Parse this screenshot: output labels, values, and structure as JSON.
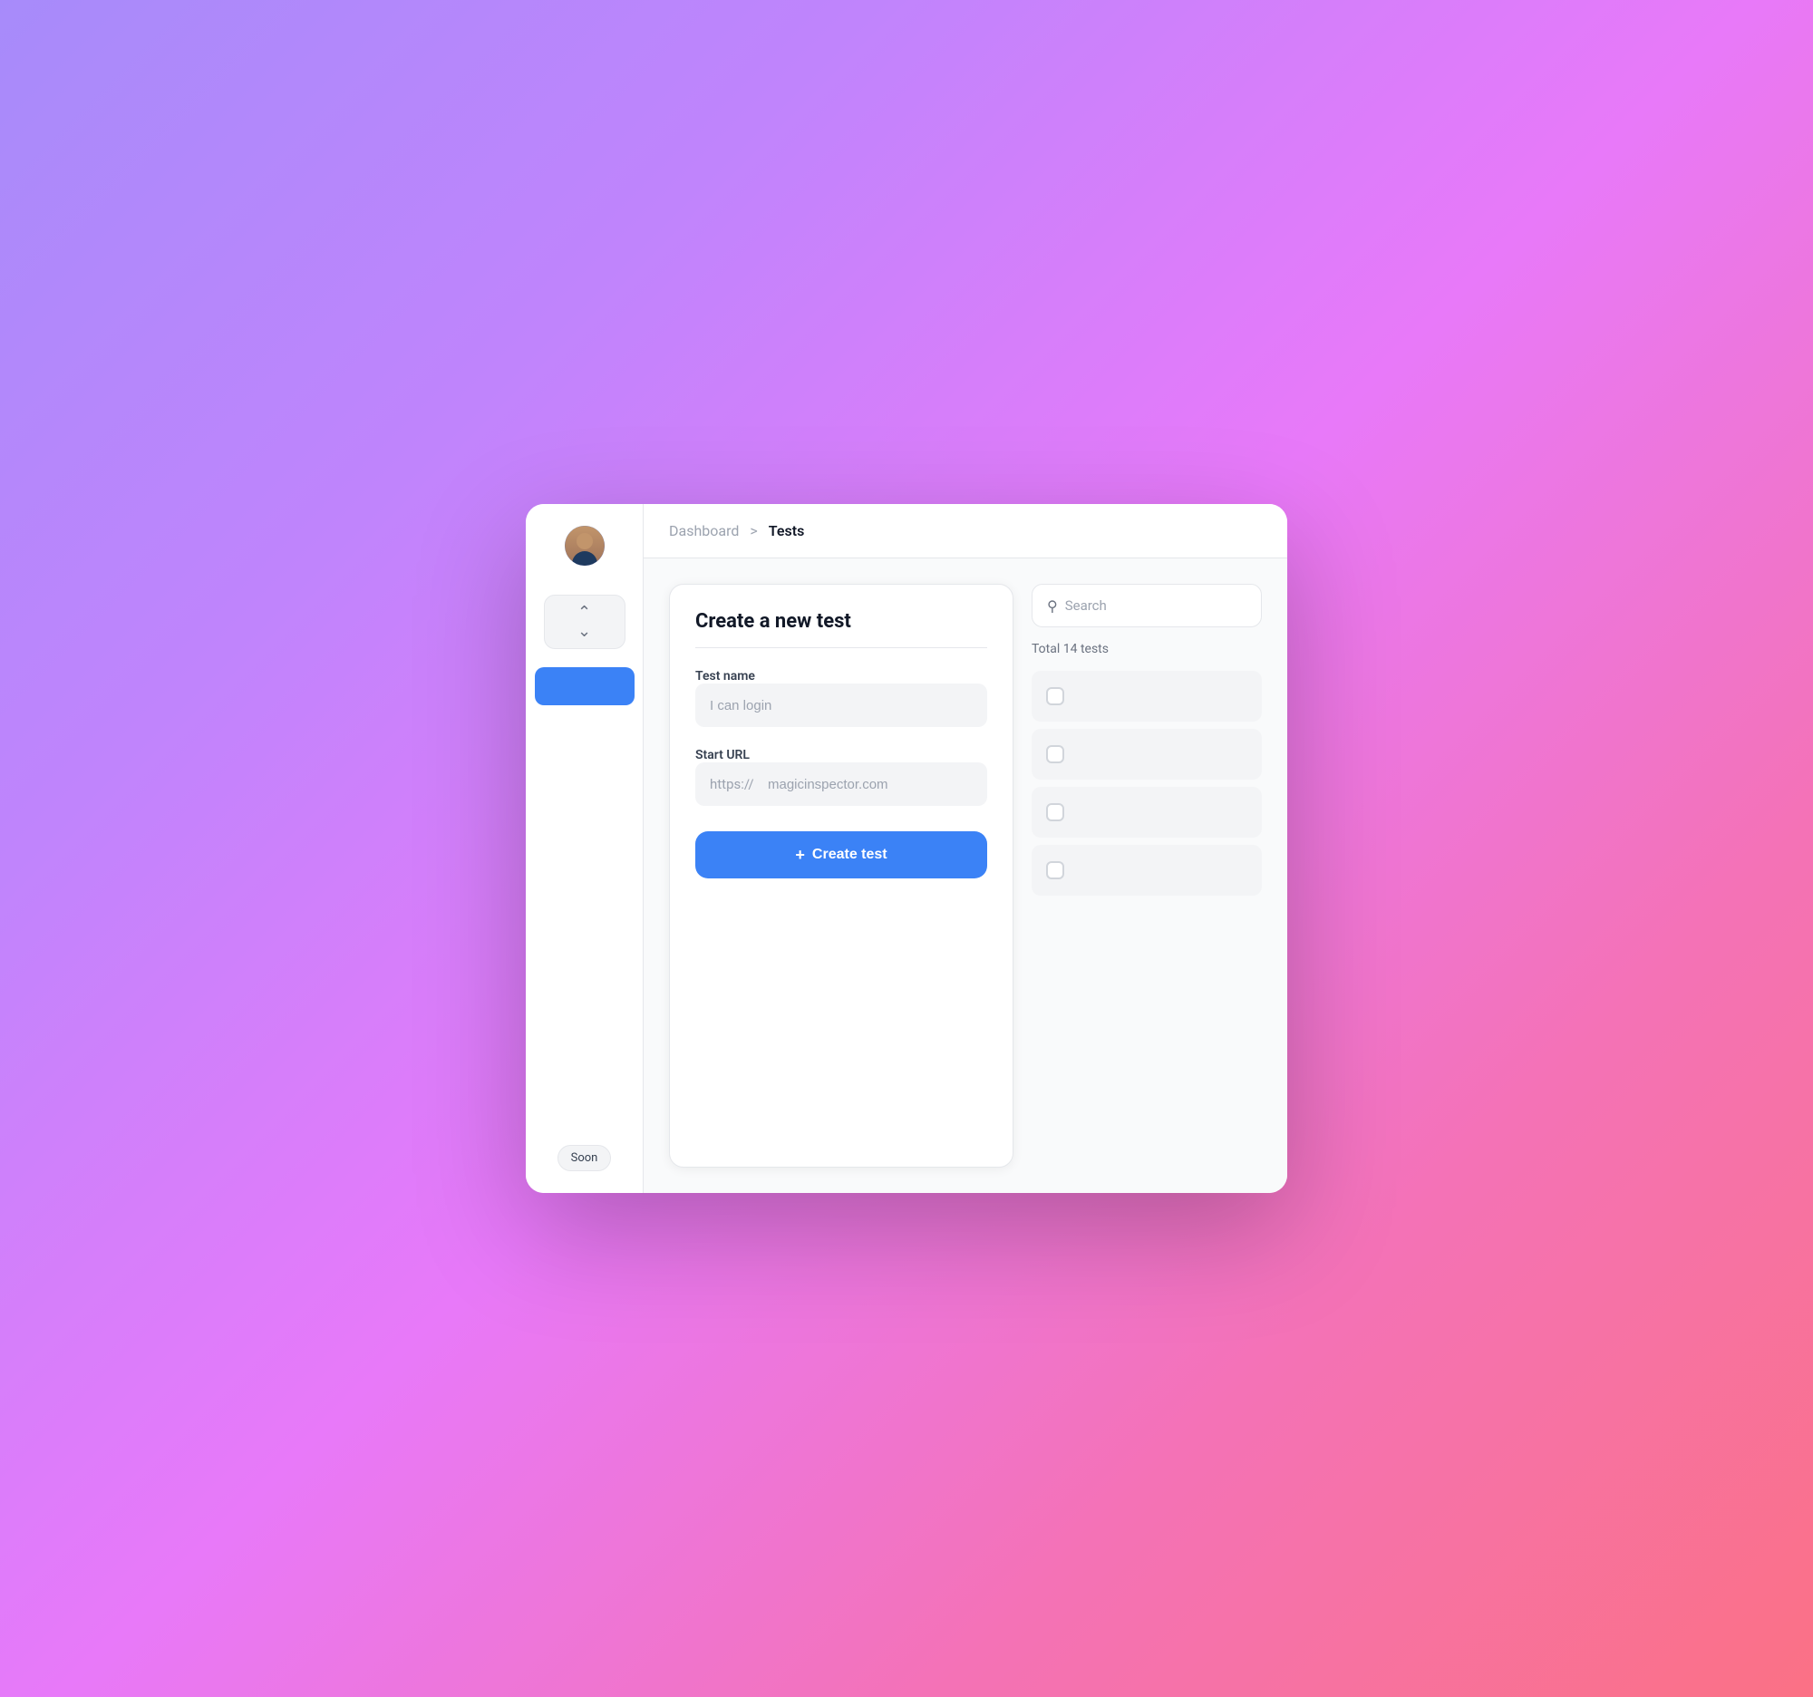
{
  "background": {
    "gradient": "purple-pink"
  },
  "sidebar": {
    "avatar_alt": "User avatar",
    "nav_selector_icon": "chevrons-up-down",
    "soon_label": "Soon"
  },
  "header": {
    "breadcrumb_dashboard": "Dashboard",
    "breadcrumb_separator": ">",
    "breadcrumb_current": "Tests"
  },
  "create_card": {
    "title": "Create a new test",
    "test_name_label": "Test name",
    "test_name_placeholder": "I can login",
    "start_url_label": "Start URL",
    "url_prefix": "https://",
    "url_placeholder": "magicinspector.com",
    "create_button_label": "Create test",
    "create_button_icon": "plus"
  },
  "right_panel": {
    "search_placeholder": "Search",
    "total_label": "Total 14 tests",
    "test_items": [
      {
        "id": 1
      },
      {
        "id": 2
      },
      {
        "id": 3
      },
      {
        "id": 4
      }
    ]
  }
}
